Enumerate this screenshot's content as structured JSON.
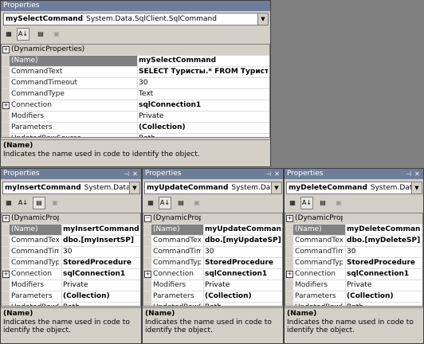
{
  "top": {
    "title": "Properties",
    "object_name": "mySelectCommand",
    "object_type": "System.Data.SqlClient.SqlCommand",
    "rows": [
      {
        "label": "(DynamicProperties)",
        "value": "",
        "expander": "+",
        "category": true
      },
      {
        "label": "(Name)",
        "value": "mySelectCommand",
        "selected": true,
        "bold": true
      },
      {
        "label": "CommandText",
        "value": "SELECT Туристы.* FROM Туристы",
        "bold": true
      },
      {
        "label": "CommandTimeout",
        "value": "30"
      },
      {
        "label": "CommandType",
        "value": "Text"
      },
      {
        "label": "Connection",
        "value": "sqlConnection1",
        "expander": "+",
        "bold": true
      },
      {
        "label": "Modifiers",
        "value": "Private"
      },
      {
        "label": "Parameters",
        "value": "(Collection)",
        "bold": true
      },
      {
        "label": "UpdatedRowSource",
        "value": "Both"
      }
    ],
    "desc_name": "(Name)",
    "desc_text": "Indicates the name used in code to identify the object."
  },
  "insert": {
    "title": "Properties",
    "object_name": "myInsertCommand",
    "object_type": "System.Data.SqlCli",
    "rows": [
      {
        "label": "(DynamicPropert",
        "value": "",
        "expander": "+",
        "category": true
      },
      {
        "label": "(Name)",
        "value": "myInsertCommand",
        "selected": true,
        "bold": true
      },
      {
        "label": "CommandText",
        "value": "dbo.[myInsertSP]",
        "bold": true
      },
      {
        "label": "CommandTimeou",
        "value": "30"
      },
      {
        "label": "CommandType",
        "value": "StoredProcedure",
        "bold": true
      },
      {
        "label": "Connection",
        "value": "sqlConnection1",
        "expander": "+",
        "bold": true
      },
      {
        "label": "Modifiers",
        "value": "Private"
      },
      {
        "label": "Parameters",
        "value": "(Collection)",
        "bold": true
      },
      {
        "label": "UpdatedRowSou",
        "value": "Both"
      }
    ],
    "desc_name": "(Name)",
    "desc_text": "Indicates the name used in code to identify the object."
  },
  "update": {
    "title": "Properties",
    "object_name": "myUpdateCommand",
    "object_type": "System.Data.SqlC",
    "rows": [
      {
        "label": "(DynamicPropert",
        "value": "",
        "expander": "-",
        "category": true
      },
      {
        "label": "(Name)",
        "value": "myUpdateCommand",
        "selected": true,
        "bold": true
      },
      {
        "label": "CommandText",
        "value": "dbo.[myUpdateSP]",
        "bold": true
      },
      {
        "label": "CommandTimeou",
        "value": "30"
      },
      {
        "label": "CommandType",
        "value": "StoredProcedure",
        "bold": true
      },
      {
        "label": "Connection",
        "value": "sqlConnection1",
        "expander": "+",
        "bold": true
      },
      {
        "label": "Modifiers",
        "value": "Private"
      },
      {
        "label": "Parameters",
        "value": "(Collection)",
        "bold": true
      },
      {
        "label": "UpdatedRowSou",
        "value": "Both"
      }
    ],
    "desc_name": "(Name)",
    "desc_text": "Indicates the name used in code to identify the object."
  },
  "delete": {
    "title": "Properties",
    "object_name": "myDeleteCommand",
    "object_type": "System.Data.SqlC",
    "rows": [
      {
        "label": "(DynamicPropert",
        "value": "",
        "expander": "+",
        "category": true
      },
      {
        "label": "(Name)",
        "value": "myDeleteCommand",
        "selected": true,
        "bold": true
      },
      {
        "label": "CommandText",
        "value": "dbo.[myDeleteSP]",
        "bold": true
      },
      {
        "label": "CommandTimeou",
        "value": "30"
      },
      {
        "label": "CommandType",
        "value": "StoredProcedure",
        "bold": true
      },
      {
        "label": "Connection",
        "value": "sqlConnection1",
        "expander": "+",
        "bold": true
      },
      {
        "label": "Modifiers",
        "value": "Private"
      },
      {
        "label": "Parameters",
        "value": "(Collection)",
        "bold": true
      },
      {
        "label": "UpdatedRowSou",
        "value": "Both"
      }
    ],
    "desc_name": "(Name)",
    "desc_text": "Indicates the name used in code to identify the object."
  },
  "toolbar_icons": [
    "categorized-icon",
    "alphabetical-icon",
    "properties-icon",
    "property-pages-icon"
  ],
  "colors": {
    "titlebar": "#6e7e9a",
    "selection": "#808080",
    "chrome": "#d4d0c8"
  }
}
